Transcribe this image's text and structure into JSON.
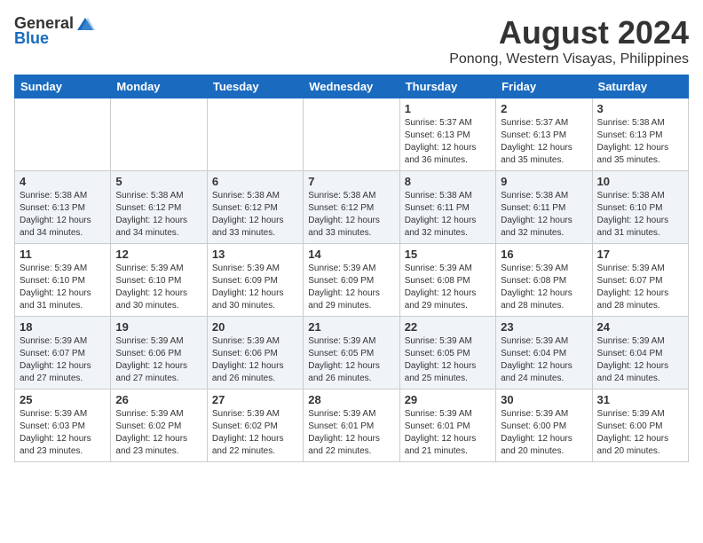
{
  "logo": {
    "general": "General",
    "blue": "Blue"
  },
  "title": "August 2024",
  "subtitle": "Ponong, Western Visayas, Philippines",
  "days_of_week": [
    "Sunday",
    "Monday",
    "Tuesday",
    "Wednesday",
    "Thursday",
    "Friday",
    "Saturday"
  ],
  "weeks": [
    [
      {
        "day": "",
        "detail": ""
      },
      {
        "day": "",
        "detail": ""
      },
      {
        "day": "",
        "detail": ""
      },
      {
        "day": "",
        "detail": ""
      },
      {
        "day": "1",
        "detail": "Sunrise: 5:37 AM\nSunset: 6:13 PM\nDaylight: 12 hours\nand 36 minutes."
      },
      {
        "day": "2",
        "detail": "Sunrise: 5:37 AM\nSunset: 6:13 PM\nDaylight: 12 hours\nand 35 minutes."
      },
      {
        "day": "3",
        "detail": "Sunrise: 5:38 AM\nSunset: 6:13 PM\nDaylight: 12 hours\nand 35 minutes."
      }
    ],
    [
      {
        "day": "4",
        "detail": "Sunrise: 5:38 AM\nSunset: 6:13 PM\nDaylight: 12 hours\nand 34 minutes."
      },
      {
        "day": "5",
        "detail": "Sunrise: 5:38 AM\nSunset: 6:12 PM\nDaylight: 12 hours\nand 34 minutes."
      },
      {
        "day": "6",
        "detail": "Sunrise: 5:38 AM\nSunset: 6:12 PM\nDaylight: 12 hours\nand 33 minutes."
      },
      {
        "day": "7",
        "detail": "Sunrise: 5:38 AM\nSunset: 6:12 PM\nDaylight: 12 hours\nand 33 minutes."
      },
      {
        "day": "8",
        "detail": "Sunrise: 5:38 AM\nSunset: 6:11 PM\nDaylight: 12 hours\nand 32 minutes."
      },
      {
        "day": "9",
        "detail": "Sunrise: 5:38 AM\nSunset: 6:11 PM\nDaylight: 12 hours\nand 32 minutes."
      },
      {
        "day": "10",
        "detail": "Sunrise: 5:38 AM\nSunset: 6:10 PM\nDaylight: 12 hours\nand 31 minutes."
      }
    ],
    [
      {
        "day": "11",
        "detail": "Sunrise: 5:39 AM\nSunset: 6:10 PM\nDaylight: 12 hours\nand 31 minutes."
      },
      {
        "day": "12",
        "detail": "Sunrise: 5:39 AM\nSunset: 6:10 PM\nDaylight: 12 hours\nand 30 minutes."
      },
      {
        "day": "13",
        "detail": "Sunrise: 5:39 AM\nSunset: 6:09 PM\nDaylight: 12 hours\nand 30 minutes."
      },
      {
        "day": "14",
        "detail": "Sunrise: 5:39 AM\nSunset: 6:09 PM\nDaylight: 12 hours\nand 29 minutes."
      },
      {
        "day": "15",
        "detail": "Sunrise: 5:39 AM\nSunset: 6:08 PM\nDaylight: 12 hours\nand 29 minutes."
      },
      {
        "day": "16",
        "detail": "Sunrise: 5:39 AM\nSunset: 6:08 PM\nDaylight: 12 hours\nand 28 minutes."
      },
      {
        "day": "17",
        "detail": "Sunrise: 5:39 AM\nSunset: 6:07 PM\nDaylight: 12 hours\nand 28 minutes."
      }
    ],
    [
      {
        "day": "18",
        "detail": "Sunrise: 5:39 AM\nSunset: 6:07 PM\nDaylight: 12 hours\nand 27 minutes."
      },
      {
        "day": "19",
        "detail": "Sunrise: 5:39 AM\nSunset: 6:06 PM\nDaylight: 12 hours\nand 27 minutes."
      },
      {
        "day": "20",
        "detail": "Sunrise: 5:39 AM\nSunset: 6:06 PM\nDaylight: 12 hours\nand 26 minutes."
      },
      {
        "day": "21",
        "detail": "Sunrise: 5:39 AM\nSunset: 6:05 PM\nDaylight: 12 hours\nand 26 minutes."
      },
      {
        "day": "22",
        "detail": "Sunrise: 5:39 AM\nSunset: 6:05 PM\nDaylight: 12 hours\nand 25 minutes."
      },
      {
        "day": "23",
        "detail": "Sunrise: 5:39 AM\nSunset: 6:04 PM\nDaylight: 12 hours\nand 24 minutes."
      },
      {
        "day": "24",
        "detail": "Sunrise: 5:39 AM\nSunset: 6:04 PM\nDaylight: 12 hours\nand 24 minutes."
      }
    ],
    [
      {
        "day": "25",
        "detail": "Sunrise: 5:39 AM\nSunset: 6:03 PM\nDaylight: 12 hours\nand 23 minutes."
      },
      {
        "day": "26",
        "detail": "Sunrise: 5:39 AM\nSunset: 6:02 PM\nDaylight: 12 hours\nand 23 minutes."
      },
      {
        "day": "27",
        "detail": "Sunrise: 5:39 AM\nSunset: 6:02 PM\nDaylight: 12 hours\nand 22 minutes."
      },
      {
        "day": "28",
        "detail": "Sunrise: 5:39 AM\nSunset: 6:01 PM\nDaylight: 12 hours\nand 22 minutes."
      },
      {
        "day": "29",
        "detail": "Sunrise: 5:39 AM\nSunset: 6:01 PM\nDaylight: 12 hours\nand 21 minutes."
      },
      {
        "day": "30",
        "detail": "Sunrise: 5:39 AM\nSunset: 6:00 PM\nDaylight: 12 hours\nand 20 minutes."
      },
      {
        "day": "31",
        "detail": "Sunrise: 5:39 AM\nSunset: 6:00 PM\nDaylight: 12 hours\nand 20 minutes."
      }
    ]
  ]
}
